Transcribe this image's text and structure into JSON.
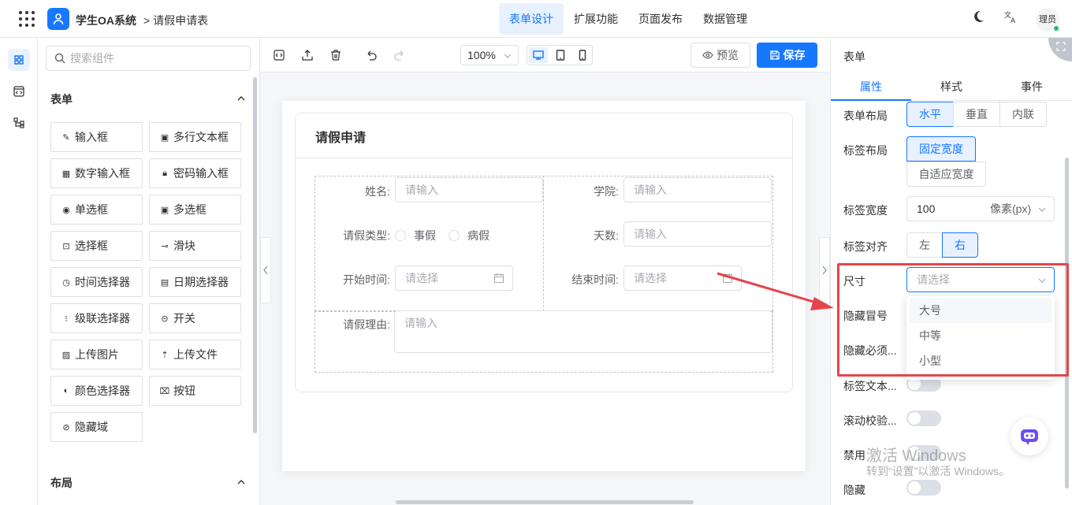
{
  "header": {
    "app_title": "学生OA系统",
    "breadcrumb": "> 请假申请表",
    "nav": [
      "表单设计",
      "扩展功能",
      "页面发布",
      "数据管理"
    ],
    "avatar_text": "理员"
  },
  "left_panel": {
    "search_placeholder": "搜索组件",
    "section_form": "表单",
    "components": [
      {
        "label": "输入框",
        "icon": "pencil-icon"
      },
      {
        "label": "多行文本框",
        "icon": "textarea-icon"
      },
      {
        "label": "数字输入框",
        "icon": "number-icon"
      },
      {
        "label": "密码输入框",
        "icon": "lock-icon"
      },
      {
        "label": "单选框",
        "icon": "radio-icon"
      },
      {
        "label": "多选框",
        "icon": "checkbox-icon"
      },
      {
        "label": "选择框",
        "icon": "select-icon"
      },
      {
        "label": "滑块",
        "icon": "slider-icon"
      },
      {
        "label": "时间选择器",
        "icon": "clock-icon"
      },
      {
        "label": "日期选择器",
        "icon": "calendar-icon"
      },
      {
        "label": "级联选择器",
        "icon": "cascader-icon"
      },
      {
        "label": "开关",
        "icon": "switch-icon"
      },
      {
        "label": "上传图片",
        "icon": "image-icon"
      },
      {
        "label": "上传文件",
        "icon": "upload-icon"
      },
      {
        "label": "颜色选择器",
        "icon": "palette-icon"
      },
      {
        "label": "按钮",
        "icon": "button-icon"
      },
      {
        "label": "隐藏域",
        "icon": "eye-off-icon"
      }
    ],
    "section_layout": "布局"
  },
  "toolbar": {
    "zoom": "100%",
    "preview_label": "预览",
    "save_label": "保存"
  },
  "form": {
    "title": "请假申请",
    "fields": {
      "name_label": "姓名:",
      "name_placeholder": "请输入",
      "college_label": "学院:",
      "college_placeholder": "请输入",
      "type_label": "请假类型:",
      "type_options": [
        "事假",
        "病假"
      ],
      "days_label": "天数:",
      "days_placeholder": "请输入",
      "start_label": "开始时间:",
      "start_placeholder": "请选择",
      "end_label": "结束时间:",
      "end_placeholder": "请选择",
      "reason_label": "请假理由:",
      "reason_placeholder": "请输入"
    }
  },
  "right_panel": {
    "title": "表单",
    "tabs": [
      "属性",
      "样式",
      "事件"
    ],
    "form_layout_label": "表单布局",
    "form_layout_options": [
      "水平",
      "垂直",
      "内联"
    ],
    "label_layout_label": "标签布局",
    "label_layout_options": [
      "固定宽度",
      "自适应宽度"
    ],
    "label_width_label": "标签宽度",
    "label_width_value": "100",
    "label_width_unit": "像素(px)",
    "label_align_label": "标签对齐",
    "label_align_options": [
      "左",
      "右"
    ],
    "size_label": "尺寸",
    "size_placeholder": "请选择",
    "size_options": [
      "大号",
      "中等",
      "小型"
    ],
    "hide_colon_label": "隐藏冒号",
    "hide_required_label": "隐藏必须...",
    "label_text_label": "标签文本...",
    "scroll_validate_label": "滚动校验...",
    "disabled_label": "禁用",
    "hidden_label": "隐藏"
  },
  "watermark": {
    "line1": "激活 Windows",
    "line2": "转到“设置”以激活 Windows。"
  },
  "colors": {
    "accent": "#1677ff",
    "highlight": "#e4454c"
  }
}
